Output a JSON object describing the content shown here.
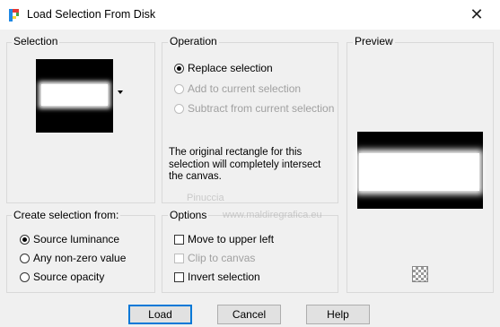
{
  "window": {
    "title": "Load Selection From Disk",
    "close_glyph": "✕"
  },
  "selection": {
    "label": "Selection"
  },
  "operation": {
    "label": "Operation",
    "options": [
      "Replace selection",
      "Add to current selection",
      "Subtract from current selection"
    ],
    "selected": "Replace selection",
    "note": "The original rectangle for this selection will completely intersect the canvas."
  },
  "preview": {
    "label": "Preview"
  },
  "create": {
    "label": "Create selection from:",
    "options": [
      "Source luminance",
      "Any non-zero value",
      "Source opacity"
    ],
    "selected": "Source luminance"
  },
  "options": {
    "label": "Options",
    "move_upper_left": "Move to upper left",
    "clip_to_canvas": "Clip to canvas",
    "invert_selection": "Invert selection"
  },
  "buttons": {
    "load": "Load",
    "cancel": "Cancel",
    "help": "Help"
  },
  "watermark": {
    "line1": "Pinuccia",
    "line2": "www.maldiregrafica.eu"
  }
}
